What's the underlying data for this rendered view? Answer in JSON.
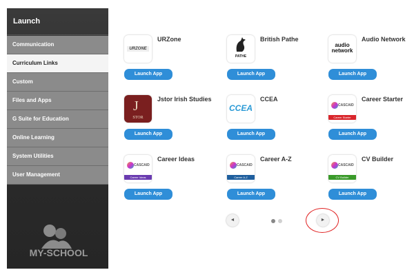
{
  "sidebar": {
    "title": "Launch",
    "items": [
      {
        "label": "Communication"
      },
      {
        "label": "Curriculum Links"
      },
      {
        "label": "Custom"
      },
      {
        "label": "Files and Apps"
      },
      {
        "label": "G Suite for Education"
      },
      {
        "label": "Online Learning"
      },
      {
        "label": "System Utilities"
      },
      {
        "label": "User Management"
      }
    ],
    "active_item": "Curriculum Links",
    "logo_text": "MY-SCHOOL"
  },
  "apps": [
    {
      "name": "URZone",
      "button": "Launch App",
      "tile_text": "URZONE"
    },
    {
      "name": "British Pathe",
      "button": "Launch App",
      "tile_text": "PATHE"
    },
    {
      "name": "Audio Network",
      "button": "Launch App",
      "tile_text": "audio network"
    },
    {
      "name": "Jstor Irish Studies",
      "button": "Launch App",
      "tile_text": "STOR"
    },
    {
      "name": "CCEA",
      "button": "Launch App",
      "tile_text": "CCEA"
    },
    {
      "name": "Career Starter",
      "button": "Launch App",
      "tile_text": "CASCAID",
      "ribbon": "Career Starter"
    },
    {
      "name": "Career Ideas",
      "button": "Launch App",
      "tile_text": "CASCAID",
      "ribbon": "Career Ideas"
    },
    {
      "name": "Career A-Z",
      "button": "Launch App",
      "tile_text": "CASCAID",
      "ribbon": "Career A-Z"
    },
    {
      "name": "CV Builder",
      "button": "Launch App",
      "tile_text": "CASCAID",
      "ribbon": "CV Builder"
    }
  ],
  "pager": {
    "prev_icon": "◄",
    "next_icon": "►",
    "pages": 2,
    "current_page": 1
  },
  "colors": {
    "accent": "#2f8ed8",
    "sidebar_dark": "#2f2f2f",
    "sidebar_item": "#8b8b8b",
    "highlight": "#e02020"
  }
}
